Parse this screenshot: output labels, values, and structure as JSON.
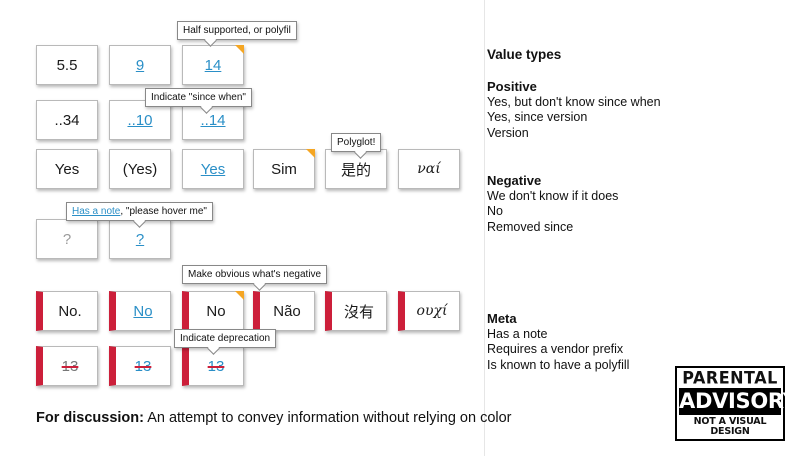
{
  "grid": {
    "row1": [
      "5.5",
      "9",
      "14"
    ],
    "row2": [
      "..34",
      "..10",
      "..14"
    ],
    "row3": [
      "Yes",
      "(Yes)",
      "Yes",
      "Sim",
      "是的",
      "ναί"
    ],
    "row4": [
      "?",
      "?"
    ],
    "row5": [
      "No.",
      "No",
      "No",
      "Não",
      "沒有",
      "ουχί"
    ],
    "row6": [
      "13",
      "13",
      "13"
    ]
  },
  "tooltips": {
    "half_supported": "Half supported, or polyfil",
    "since_when": "Indicate \"since when\"",
    "polyglot": "Polyglot!",
    "note_link": "Has a note",
    "note_rest": ", \"please hover me\"",
    "negative": "Make obvious what's negative",
    "deprecation": "Indicate deprecation"
  },
  "legend": {
    "title": "Value types",
    "positive": {
      "heading": "Positive",
      "items": [
        "Yes, but don't know since when",
        "Yes, since version",
        "Version"
      ]
    },
    "negative": {
      "heading": "Negative",
      "items": [
        "We don't know if it does",
        "No",
        "Removed since"
      ]
    },
    "meta": {
      "heading": "Meta",
      "items": [
        "Has a note",
        "Requires a vendor prefix",
        "Is known to have a polyfill"
      ]
    }
  },
  "discussion": {
    "label": "For discussion:",
    "text": " An attempt to convey information without relying on color"
  },
  "advisory": {
    "top": "PARENTAL",
    "middle": "ADVISORY",
    "bottom": "NOT A VISUAL DESIGN"
  },
  "colors": {
    "negative_bar": "#cc1f3a",
    "flag": "#f5a623",
    "link": "#2a8fc7"
  }
}
